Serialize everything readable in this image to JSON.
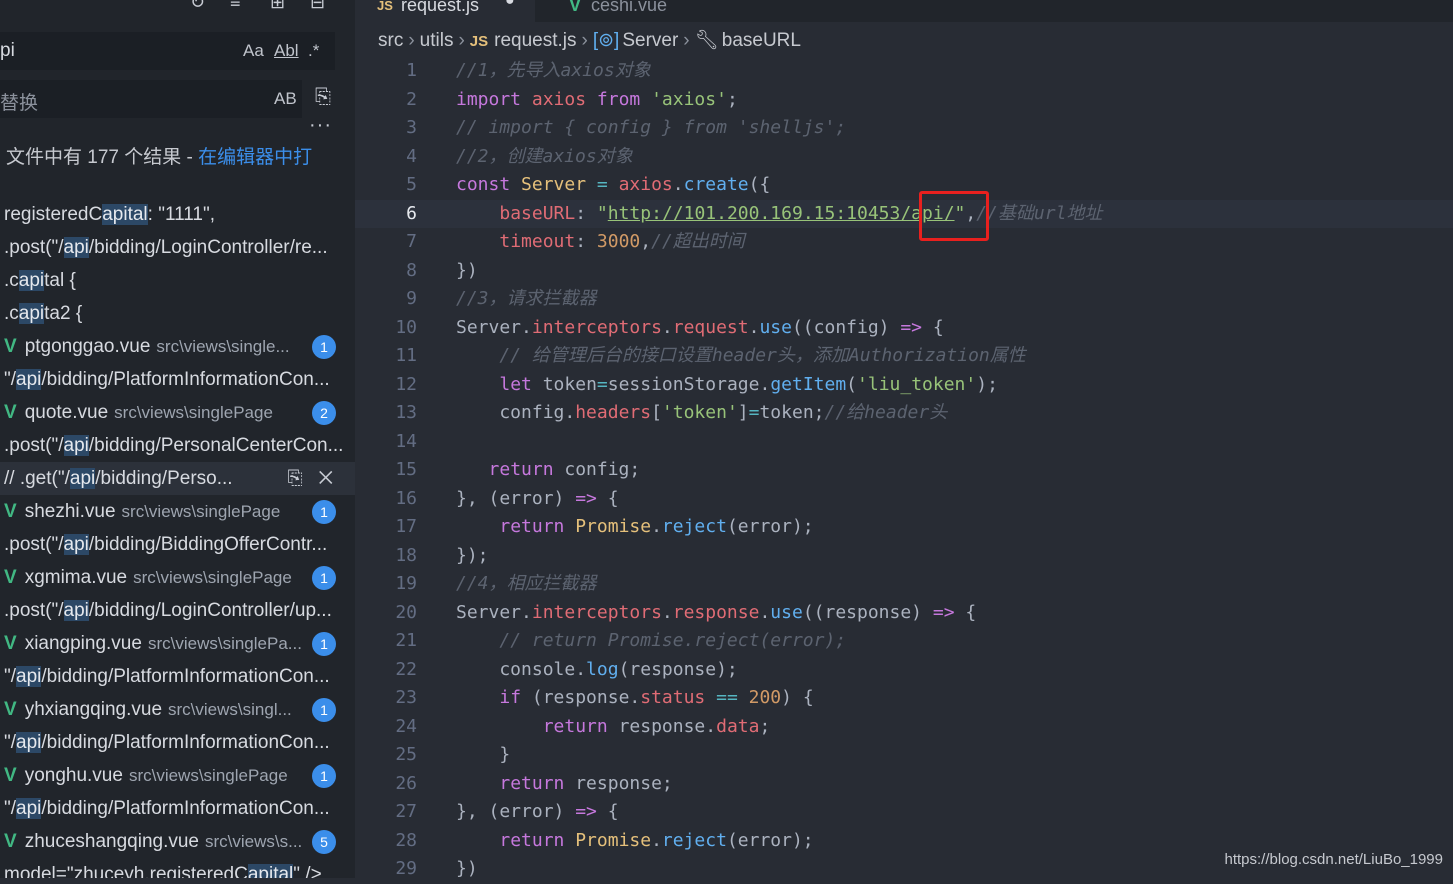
{
  "search": {
    "query": "pi",
    "opt_case": "Aa",
    "opt_word": "Abl",
    "opt_regex": ".*",
    "replace_placeholder": "替换",
    "opt_preserve": "AB",
    "more": "···",
    "summary_text": "文件中有 177 个结果 - ",
    "summary_link": "在编辑器中打"
  },
  "results": [
    {
      "type": "line",
      "pre": "registeredC",
      "hl": "apital",
      "post": ": \"1111\","
    },
    {
      "type": "line",
      "pre": ".post(\"/",
      "hl": "api",
      "post": "/bidding/LoginController/re..."
    },
    {
      "type": "line",
      "pre": ".c",
      "hl": "api",
      "post": "tal {"
    },
    {
      "type": "line",
      "pre": ".c",
      "hl": "api",
      "post": "ta2 {"
    },
    {
      "type": "file",
      "name": "ptgonggao.vue",
      "path": "src\\views\\single...",
      "count": "1"
    },
    {
      "type": "line",
      "pre": "\"/",
      "hl": "api",
      "post": "/bidding/PlatformInformationCon..."
    },
    {
      "type": "file",
      "name": "quote.vue",
      "path": "src\\views\\singlePage",
      "count": "2"
    },
    {
      "type": "line",
      "pre": ".post(\"/",
      "hl": "api",
      "post": "/bidding/PersonalCenterCon..."
    },
    {
      "type": "line",
      "selected": true,
      "pre": "//   .get(\"/",
      "hl": "api",
      "post": "/bidding/Perso..."
    },
    {
      "type": "file",
      "name": "shezhi.vue",
      "path": "src\\views\\singlePage",
      "count": "1"
    },
    {
      "type": "line",
      "pre": ".post(\"/",
      "hl": "api",
      "post": "/bidding/BiddingOfferContr..."
    },
    {
      "type": "file",
      "name": "xgmima.vue",
      "path": "src\\views\\singlePage",
      "count": "1"
    },
    {
      "type": "line",
      "pre": ".post(\"/",
      "hl": "api",
      "post": "/bidding/LoginController/up..."
    },
    {
      "type": "file",
      "name": "xiangping.vue",
      "path": "src\\views\\singlePa...",
      "count": "1"
    },
    {
      "type": "line",
      "pre": "\"/",
      "hl": "api",
      "post": "/bidding/PlatformInformationCon..."
    },
    {
      "type": "file",
      "name": "yhxiangqing.vue",
      "path": "src\\views\\singl...",
      "count": "1"
    },
    {
      "type": "line",
      "pre": "\"/",
      "hl": "api",
      "post": "/bidding/PlatformInformationCon..."
    },
    {
      "type": "file",
      "name": "yonghu.vue",
      "path": "src\\views\\singlePage",
      "count": "1"
    },
    {
      "type": "line",
      "pre": "\"/",
      "hl": "api",
      "post": "/bidding/PlatformInformationCon..."
    },
    {
      "type": "file",
      "name": "zhuceshangqing.vue",
      "path": "src\\views\\s...",
      "count": "5"
    },
    {
      "type": "line",
      "pre": "model=\"zhuceyh.registeredC",
      "hl": "apital",
      "post": "\" />"
    }
  ],
  "tabs": [
    {
      "label": "request.js"
    },
    {
      "label": "ceshi.vue"
    }
  ],
  "breadcrumb": {
    "items": [
      "src",
      "utils",
      "request.js",
      "Server",
      "baseURL"
    ],
    "js_badge": "JS"
  },
  "code": [
    [
      [
        "c",
        "//1，先导入axios对象"
      ]
    ],
    [
      [
        "k",
        "import "
      ],
      [
        "v",
        "axios "
      ],
      [
        "k",
        "from "
      ],
      [
        "s",
        "'axios'"
      ],
      [
        "p",
        ";"
      ]
    ],
    [
      [
        "c",
        "// import { config } from 'shelljs';"
      ]
    ],
    [
      [
        "c",
        "//2，创建axios对象"
      ]
    ],
    [
      [
        "k",
        "const "
      ],
      [
        "t",
        "Server "
      ],
      [
        "o",
        "= "
      ],
      [
        "v",
        "axios"
      ],
      [
        "p",
        "."
      ],
      [
        "f",
        "create"
      ],
      [
        "p",
        "({"
      ]
    ],
    [
      [
        "p",
        "    "
      ],
      [
        "v",
        "baseURL"
      ],
      [
        "p",
        ": "
      ],
      [
        "s",
        "\""
      ],
      [
        "su",
        "http://101.200.169.15:10453/api/"
      ],
      [
        "s",
        "\""
      ],
      [
        "p",
        ","
      ],
      [
        "c",
        "//基础url地址"
      ]
    ],
    [
      [
        "p",
        "    "
      ],
      [
        "v",
        "timeout"
      ],
      [
        "p",
        ": "
      ],
      [
        "n",
        "3000"
      ],
      [
        "p",
        ","
      ],
      [
        "c",
        "//超出时间"
      ]
    ],
    [
      [
        "p",
        "})"
      ]
    ],
    [
      [
        "c",
        "//3，请求拦截器"
      ]
    ],
    [
      [
        "p",
        "Server."
      ],
      [
        "v",
        "interceptors"
      ],
      [
        "p",
        "."
      ],
      [
        "v",
        "request"
      ],
      [
        "p",
        "."
      ],
      [
        "f",
        "use"
      ],
      [
        "p",
        "((config) "
      ],
      [
        "k",
        "=> "
      ],
      [
        "p",
        "{"
      ]
    ],
    [
      [
        "p",
        "    "
      ],
      [
        "c",
        "// 给管理后台的接口设置header头，添加Authorization属性"
      ]
    ],
    [
      [
        "p",
        "    "
      ],
      [
        "k",
        "let "
      ],
      [
        "p",
        "token"
      ],
      [
        "o",
        "="
      ],
      [
        "p",
        "sessionStorage."
      ],
      [
        "f",
        "getItem"
      ],
      [
        "p",
        "("
      ],
      [
        "s",
        "'liu_token'"
      ],
      [
        "p",
        ");"
      ]
    ],
    [
      [
        "p",
        "    config."
      ],
      [
        "v",
        "headers"
      ],
      [
        "p",
        "["
      ],
      [
        "s",
        "'token'"
      ],
      [
        "p",
        "]"
      ],
      [
        "o",
        "="
      ],
      [
        "p",
        "token;"
      ],
      [
        "c",
        "//给header头"
      ]
    ],
    [],
    [
      [
        "p",
        "   "
      ],
      [
        "k",
        "return "
      ],
      [
        "p",
        "config;"
      ]
    ],
    [
      [
        "p",
        "}, (error) "
      ],
      [
        "k",
        "=> "
      ],
      [
        "p",
        "{"
      ]
    ],
    [
      [
        "p",
        "    "
      ],
      [
        "k",
        "return "
      ],
      [
        "t",
        "Promise"
      ],
      [
        "p",
        "."
      ],
      [
        "f",
        "reject"
      ],
      [
        "p",
        "(error);"
      ]
    ],
    [
      [
        "p",
        "});"
      ]
    ],
    [
      [
        "c",
        "//4，相应拦截器"
      ]
    ],
    [
      [
        "p",
        "Server."
      ],
      [
        "v",
        "interceptors"
      ],
      [
        "p",
        "."
      ],
      [
        "v",
        "response"
      ],
      [
        "p",
        "."
      ],
      [
        "f",
        "use"
      ],
      [
        "p",
        "((response) "
      ],
      [
        "k",
        "=> "
      ],
      [
        "p",
        "{"
      ]
    ],
    [
      [
        "p",
        "    "
      ],
      [
        "c",
        "// return Promise.reject(error);"
      ]
    ],
    [
      [
        "p",
        "    console."
      ],
      [
        "f",
        "log"
      ],
      [
        "p",
        "(response);"
      ]
    ],
    [
      [
        "p",
        "    "
      ],
      [
        "k",
        "if "
      ],
      [
        "p",
        "(response."
      ],
      [
        "v",
        "status "
      ],
      [
        "o",
        "== "
      ],
      [
        "n",
        "200"
      ],
      [
        "p",
        ") {"
      ]
    ],
    [
      [
        "p",
        "        "
      ],
      [
        "k",
        "return "
      ],
      [
        "p",
        "response."
      ],
      [
        "v",
        "data"
      ],
      [
        "p",
        ";"
      ]
    ],
    [
      [
        "p",
        "    }"
      ]
    ],
    [
      [
        "p",
        "    "
      ],
      [
        "k",
        "return "
      ],
      [
        "p",
        "response;"
      ]
    ],
    [
      [
        "p",
        "}, (error) "
      ],
      [
        "k",
        "=> "
      ],
      [
        "p",
        "{"
      ]
    ],
    [
      [
        "p",
        "    "
      ],
      [
        "k",
        "return "
      ],
      [
        "t",
        "Promise"
      ],
      [
        "p",
        "."
      ],
      [
        "f",
        "reject"
      ],
      [
        "p",
        "(error);"
      ]
    ],
    [
      [
        "p",
        "})"
      ]
    ]
  ],
  "current_line": 6,
  "watermark": "https://blog.csdn.net/LiuBo_1999"
}
